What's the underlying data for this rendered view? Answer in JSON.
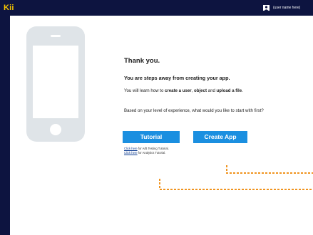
{
  "app": {
    "logo_text": "Kii",
    "logo_color": "#f6c400",
    "frame_color": "#0d1440"
  },
  "header": {
    "user_icon": "user-avatar-icon",
    "user_name": "(user name here)"
  },
  "illustration": {
    "icon": "smartphone-icon"
  },
  "content": {
    "heading": "Thank you.",
    "subheading": "You are steps away from creating your app.",
    "learn": {
      "prefix": "You will learn how to ",
      "create_user": "create a user",
      "comma": ", ",
      "object": "object",
      "and": " and ",
      "upload_file": "upload a file",
      "suffix": "."
    },
    "question": "Based on your level of experience, what would you like to start with first?"
  },
  "buttons": {
    "tutorial": "Tutorial",
    "create_app": "Create App",
    "color": "#1b8fe0"
  },
  "links": {
    "ab_link": "Click here",
    "ab_text": " for A/B Testing Tutorial.",
    "analytics_link": "Click here",
    "analytics_text": " for Analytics Tutorial."
  },
  "annotations": {
    "dash_color": "#f0941f"
  }
}
